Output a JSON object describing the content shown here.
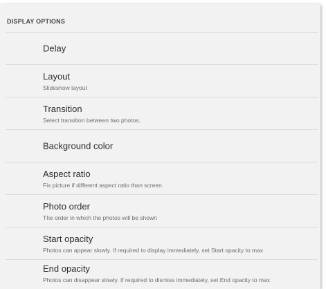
{
  "section_header": "DISPLAY OPTIONS",
  "preferences": [
    {
      "title": "Delay",
      "summary": ""
    },
    {
      "title": "Layout",
      "summary": "Slideshow layout"
    },
    {
      "title": "Transition",
      "summary": "Select transition between two photos."
    },
    {
      "title": "Background color",
      "summary": ""
    },
    {
      "title": "Aspect ratio",
      "summary": "Fix picture if different aspect ratio than screen"
    },
    {
      "title": "Photo order",
      "summary": "The order in which the photos will be shown"
    },
    {
      "title": "Start opacity",
      "summary": "Photos can appear slowly. If required to display immediately, set Start opacity to max"
    },
    {
      "title": "End opacity",
      "summary": "Photos can disappear slowly. If required to dismiss immediately, set End opacity to max"
    }
  ]
}
